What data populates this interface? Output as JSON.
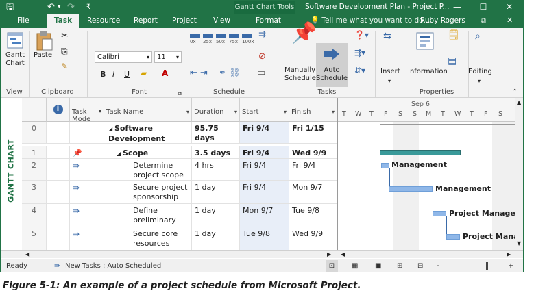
{
  "title_bar": {
    "context_tab": "Gantt Chart Tools",
    "window_title": "Software Development Plan - Project P...",
    "minimize": "—",
    "restore": "☐",
    "close": "✕"
  },
  "menu": {
    "tabs": [
      "File",
      "Task",
      "Resource",
      "Report",
      "Project",
      "View",
      "Format"
    ],
    "active_tab": "Task",
    "tell_me": "Tell me what you want to do...",
    "user": "Ruby Rogers"
  },
  "ribbon": {
    "view_group": {
      "label": "View",
      "gantt_chart": "Gantt\nChart"
    },
    "clipboard_group": {
      "label": "Clipboard",
      "paste": "Paste"
    },
    "font_group": {
      "label": "Font",
      "font_name": "Calibri",
      "font_size": "11",
      "bold": "B",
      "italic": "I",
      "underline": "U"
    },
    "schedule_group": {
      "label": "Schedule",
      "pcts": [
        "0x",
        "25x",
        "50x",
        "75x",
        "100x"
      ]
    },
    "tasks_group": {
      "label": "Tasks",
      "manually": "Manually\nSchedule",
      "auto": "Auto\nSchedule"
    },
    "insert_group": {
      "insert": "Insert"
    },
    "properties_group": {
      "label": "Properties",
      "information": "Information"
    },
    "editing_group": {
      "editing": "Editing"
    }
  },
  "side_label": "GANTT CHART",
  "grid": {
    "headers": {
      "info": "i",
      "task_mode": "Task\nMode",
      "task_name": "Task Name",
      "duration": "Duration",
      "start": "Start",
      "finish": "Finish"
    },
    "rows": [
      {
        "id": "0",
        "name": "Software Development",
        "duration": "95.75 days",
        "start": "Fri 9/4",
        "finish": "Fri 1/15",
        "level": 0,
        "summary": true
      },
      {
        "id": "1",
        "name": "Scope",
        "duration": "3.5 days",
        "start": "Fri 9/4",
        "finish": "Wed 9/9",
        "level": 1,
        "summary": true
      },
      {
        "id": "2",
        "name": "Determine project scope",
        "duration": "4 hrs",
        "start": "Fri 9/4",
        "finish": "Fri 9/4",
        "level": 2,
        "summary": false
      },
      {
        "id": "3",
        "name": "Secure project sponsorship",
        "duration": "1 day",
        "start": "Fri 9/4",
        "finish": "Mon 9/7",
        "level": 2,
        "summary": false
      },
      {
        "id": "4",
        "name": "Define preliminary",
        "duration": "1 day",
        "start": "Mon 9/7",
        "finish": "Tue 9/8",
        "level": 2,
        "summary": false
      },
      {
        "id": "5",
        "name": "Secure core resources",
        "duration": "1 day",
        "start": "Tue 9/8",
        "finish": "Wed 9/9",
        "level": 2,
        "summary": false
      }
    ]
  },
  "chart": {
    "week_label": "Sep 6",
    "days_top": [
      "T",
      "W",
      "T",
      "F",
      "S",
      "S",
      "M",
      "T",
      "W",
      "T",
      "F",
      "S"
    ],
    "bar_labels": [
      "Management",
      "Management",
      "Project Manager",
      "Project Mana"
    ]
  },
  "status_bar": {
    "ready": "Ready",
    "new_tasks": "New Tasks : Auto Scheduled",
    "zoom_minus": "-",
    "zoom_plus": "+"
  },
  "caption": "Figure 5-1: An example of a project schedule from Microsoft Project.",
  "colors": {
    "brand_green": "#217346",
    "bar_blue": "#8fb7e8",
    "summary_teal": "#3a9a9a"
  }
}
